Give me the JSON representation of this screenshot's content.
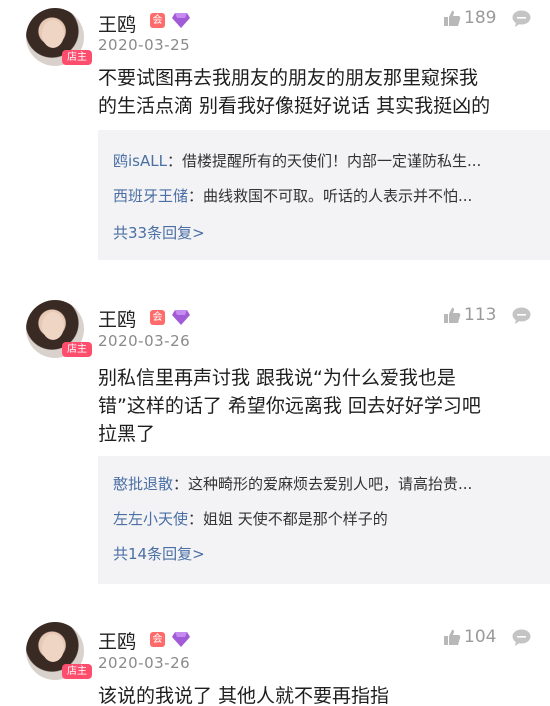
{
  "posts": [
    {
      "username": "王鸥",
      "shop_badge": "店主",
      "vip_label": "会",
      "date": "2020-03-25",
      "likes": "189",
      "content": [
        "不要试图再去我朋友的朋友的朋友那里窥探我",
        "的生活点滴 别看我好像挺好说话 其实我挺凶的"
      ],
      "replies": [
        {
          "name": "鸥isALL",
          "text": "：借楼提醒所有的天使们！内部一定谨防私生..."
        },
        {
          "name": "西班牙王储",
          "text": "：曲线救国不可取。听话的人表示并不怕..."
        }
      ],
      "more": "共33条回复>"
    },
    {
      "username": "王鸥",
      "shop_badge": "店主",
      "vip_label": "会",
      "date": "2020-03-26",
      "likes": "113",
      "content": [
        "别私信里再声讨我 跟我说“为什么爱我也是",
        "错”这样的话了 希望你远离我 回去好好学习吧",
        "拉黑了"
      ],
      "replies": [
        {
          "name": "憨批退散",
          "text": "：这种畸形的爱麻烦去爱别人吧，请高抬贵..."
        },
        {
          "name": "左左小天使",
          "text": "：姐姐 天使不都是那个样子的"
        }
      ],
      "more": "共14条回复>"
    },
    {
      "username": "王鸥",
      "shop_badge": "店主",
      "vip_label": "会",
      "date": "2020-03-26",
      "likes": "104",
      "content": [
        "该说的我说了 其他人就不要再指指"
      ]
    }
  ],
  "colors": {
    "link": "#4a6fa5",
    "badge": "#ff4d6d",
    "gem": "#a25bd6",
    "reply_bg": "#f3f3f5"
  }
}
